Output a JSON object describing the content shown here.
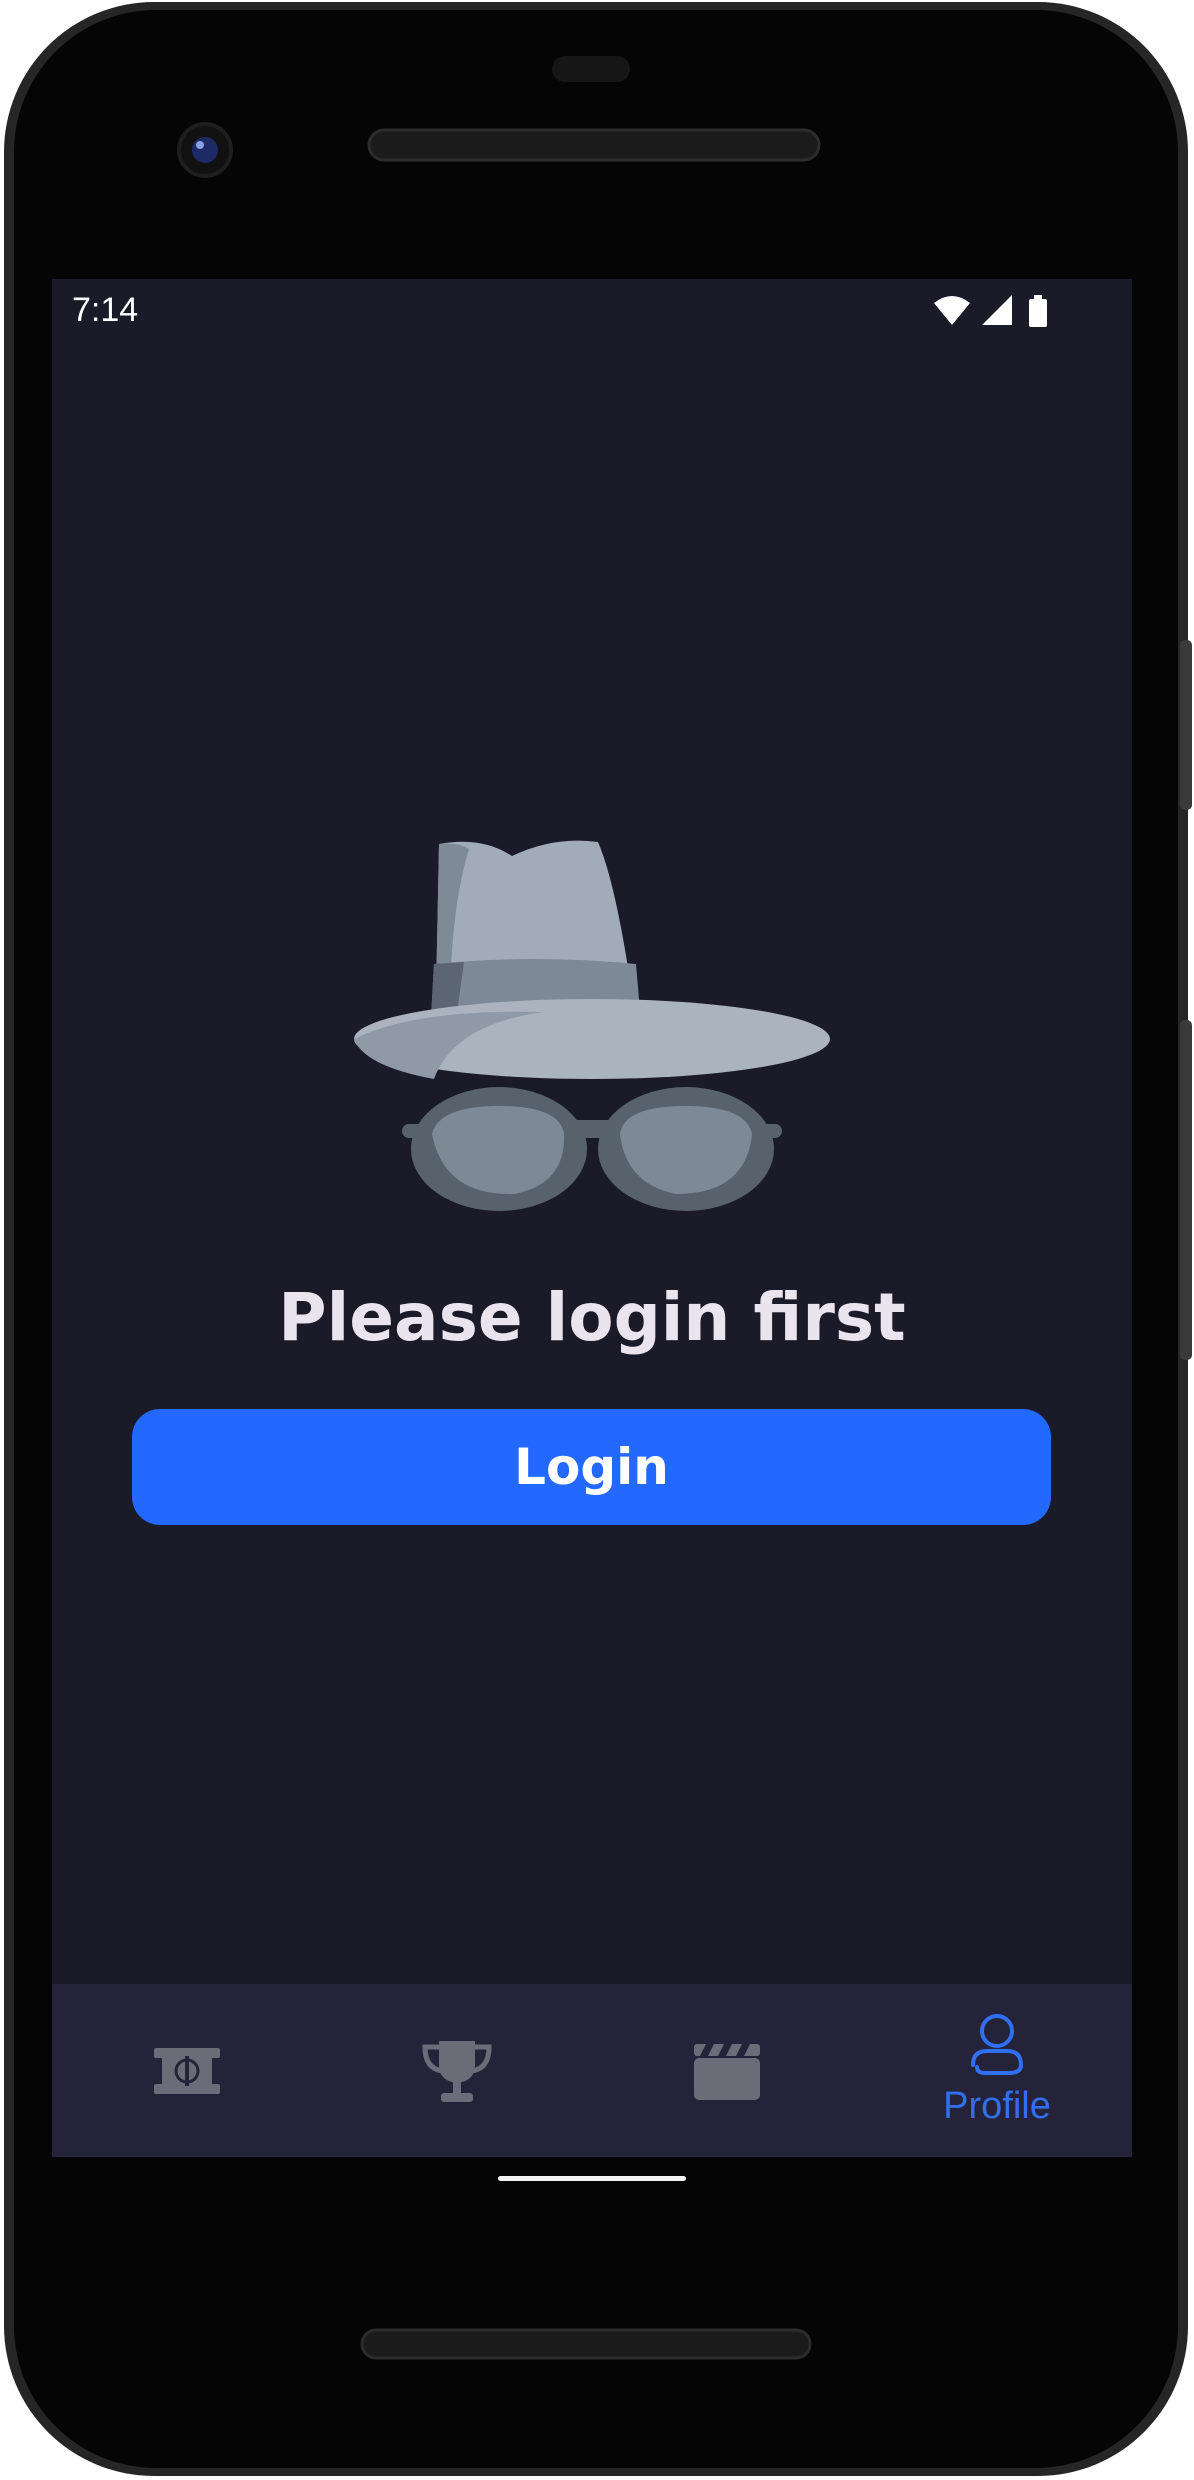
{
  "status_bar": {
    "time": "7:14",
    "icons": [
      "wifi-icon",
      "signal-icon",
      "battery-icon"
    ]
  },
  "content": {
    "illustration": "incognito-hat-glasses",
    "message": "Please login first",
    "login_label": "Login"
  },
  "bottom_nav": {
    "items": [
      {
        "icon": "stadium-field-icon",
        "label": "",
        "active": false
      },
      {
        "icon": "trophy-icon",
        "label": "",
        "active": false
      },
      {
        "icon": "clapperboard-icon",
        "label": "",
        "active": false
      },
      {
        "icon": "profile-icon",
        "label": "Profile",
        "active": true
      }
    ]
  },
  "colors": {
    "screen_bg": "#1b1a29",
    "nav_bg": "#24233a",
    "accent": "#2369ff",
    "inactive_icon": "#6b6c78"
  }
}
